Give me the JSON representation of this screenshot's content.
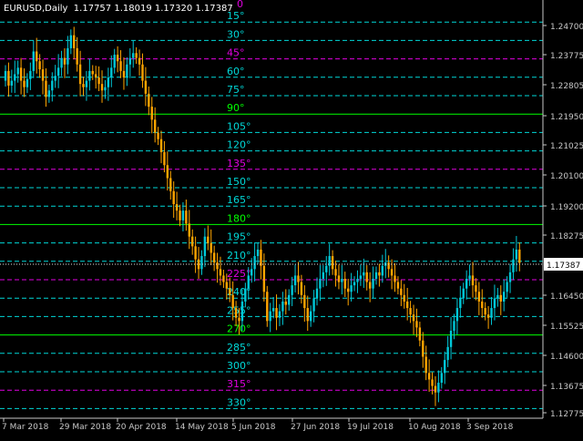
{
  "title": {
    "symbol": "EURUSD,Daily",
    "ohlc": "1.17757 1.18019 1.17320 1.17387"
  },
  "colors": {
    "background": "#000000",
    "bull_candle": "#00c8d8",
    "bear_candle": "#ffa500",
    "axis": "#c8c8c8",
    "line_cyan": "#00d8d8",
    "line_magenta": "#e000e0",
    "line_green": "#00ff00",
    "price_tag_bg": "#ffffff",
    "price_tag_text": "#000000"
  },
  "price_axis": {
    "ticks": [
      "1.24700",
      "1.23775",
      "1.22805",
      "1.21950",
      "1.21025",
      "1.20100",
      "1.19200",
      "1.18275",
      "1.17387",
      "1.16450",
      "1.15525",
      "1.14600",
      "1.13675",
      "1.12775"
    ],
    "current_price": "1.17387"
  },
  "time_axis": {
    "ticks": [
      "7 Mar 2018",
      "29 Mar 2018",
      "20 Apr 2018",
      "14 May 2018",
      "5 Jun 2018",
      "27 Jun 2018",
      "19 Jul 2018",
      "10 Aug 2018",
      "3 Sep 2018"
    ]
  },
  "gann_lines": [
    {
      "label": "0",
      "kind": "magenta"
    },
    {
      "label": "15°",
      "kind": "cyan"
    },
    {
      "label": "30°",
      "kind": "cyan"
    },
    {
      "label": "45°",
      "kind": "magenta"
    },
    {
      "label": "60°",
      "kind": "cyan"
    },
    {
      "label": "75°",
      "kind": "cyan"
    },
    {
      "label": "90°",
      "kind": "green"
    },
    {
      "label": "105°",
      "kind": "cyan"
    },
    {
      "label": "120°",
      "kind": "cyan"
    },
    {
      "label": "135°",
      "kind": "magenta"
    },
    {
      "label": "150°",
      "kind": "cyan"
    },
    {
      "label": "165°",
      "kind": "cyan"
    },
    {
      "label": "180°",
      "kind": "green"
    },
    {
      "label": "195°",
      "kind": "cyan"
    },
    {
      "label": "210°",
      "kind": "cyan"
    },
    {
      "label": "225°",
      "kind": "magenta"
    },
    {
      "label": "240°",
      "kind": "cyan"
    },
    {
      "label": "255°",
      "kind": "cyan"
    },
    {
      "label": "270°",
      "kind": "green"
    },
    {
      "label": "285°",
      "kind": "cyan"
    },
    {
      "label": "300°",
      "kind": "cyan"
    },
    {
      "label": "315°",
      "kind": "magenta"
    },
    {
      "label": "330°",
      "kind": "cyan"
    }
  ],
  "closes": [
    1.233,
    1.2285,
    1.23,
    1.232,
    1.234,
    1.23,
    1.228,
    1.2305,
    1.233,
    1.239,
    1.236,
    1.2335,
    1.23,
    1.225,
    1.227,
    1.23,
    1.2315,
    1.234,
    1.237,
    1.235,
    1.24,
    1.244,
    1.24,
    1.235,
    1.229,
    1.228,
    1.23,
    1.233,
    1.232,
    1.231,
    1.229,
    1.227,
    1.228,
    1.231,
    1.234,
    1.238,
    1.236,
    1.233,
    1.231,
    1.235,
    1.237,
    1.2385,
    1.237,
    1.235,
    1.23,
    1.226,
    1.222,
    1.218,
    1.214,
    1.212,
    1.208,
    1.204,
    1.2,
    1.196,
    1.192,
    1.19,
    1.187,
    1.19,
    1.186,
    1.182,
    1.179,
    1.175,
    1.172,
    1.176,
    1.182,
    1.18,
    1.177,
    1.174,
    1.172,
    1.17,
    1.168,
    1.166,
    1.164,
    1.16,
    1.157,
    1.156,
    1.162,
    1.166,
    1.17,
    1.172,
    1.176,
    1.178,
    1.173,
    1.165,
    1.156,
    1.159,
    1.16,
    1.157,
    1.159,
    1.162,
    1.161,
    1.164,
    1.167,
    1.17,
    1.168,
    1.164,
    1.16,
    1.156,
    1.159,
    1.163,
    1.166,
    1.169,
    1.171,
    1.173,
    1.176,
    1.172,
    1.17,
    1.168,
    1.169,
    1.166,
    1.165,
    1.167,
    1.168,
    1.169,
    1.17,
    1.171,
    1.168,
    1.166,
    1.169,
    1.171,
    1.17,
    1.173,
    1.174,
    1.172,
    1.17,
    1.168,
    1.166,
    1.164,
    1.162,
    1.16,
    1.158,
    1.156,
    1.154,
    1.15,
    1.145,
    1.14,
    1.138,
    1.136,
    1.134,
    1.137,
    1.14,
    1.144,
    1.148,
    1.153,
    1.156,
    1.16,
    1.163,
    1.166,
    1.169,
    1.17,
    1.167,
    1.165,
    1.162,
    1.16,
    1.158,
    1.157,
    1.16,
    1.163,
    1.164,
    1.162,
    1.165,
    1.168,
    1.171,
    1.175,
    1.178,
    1.1739
  ]
}
